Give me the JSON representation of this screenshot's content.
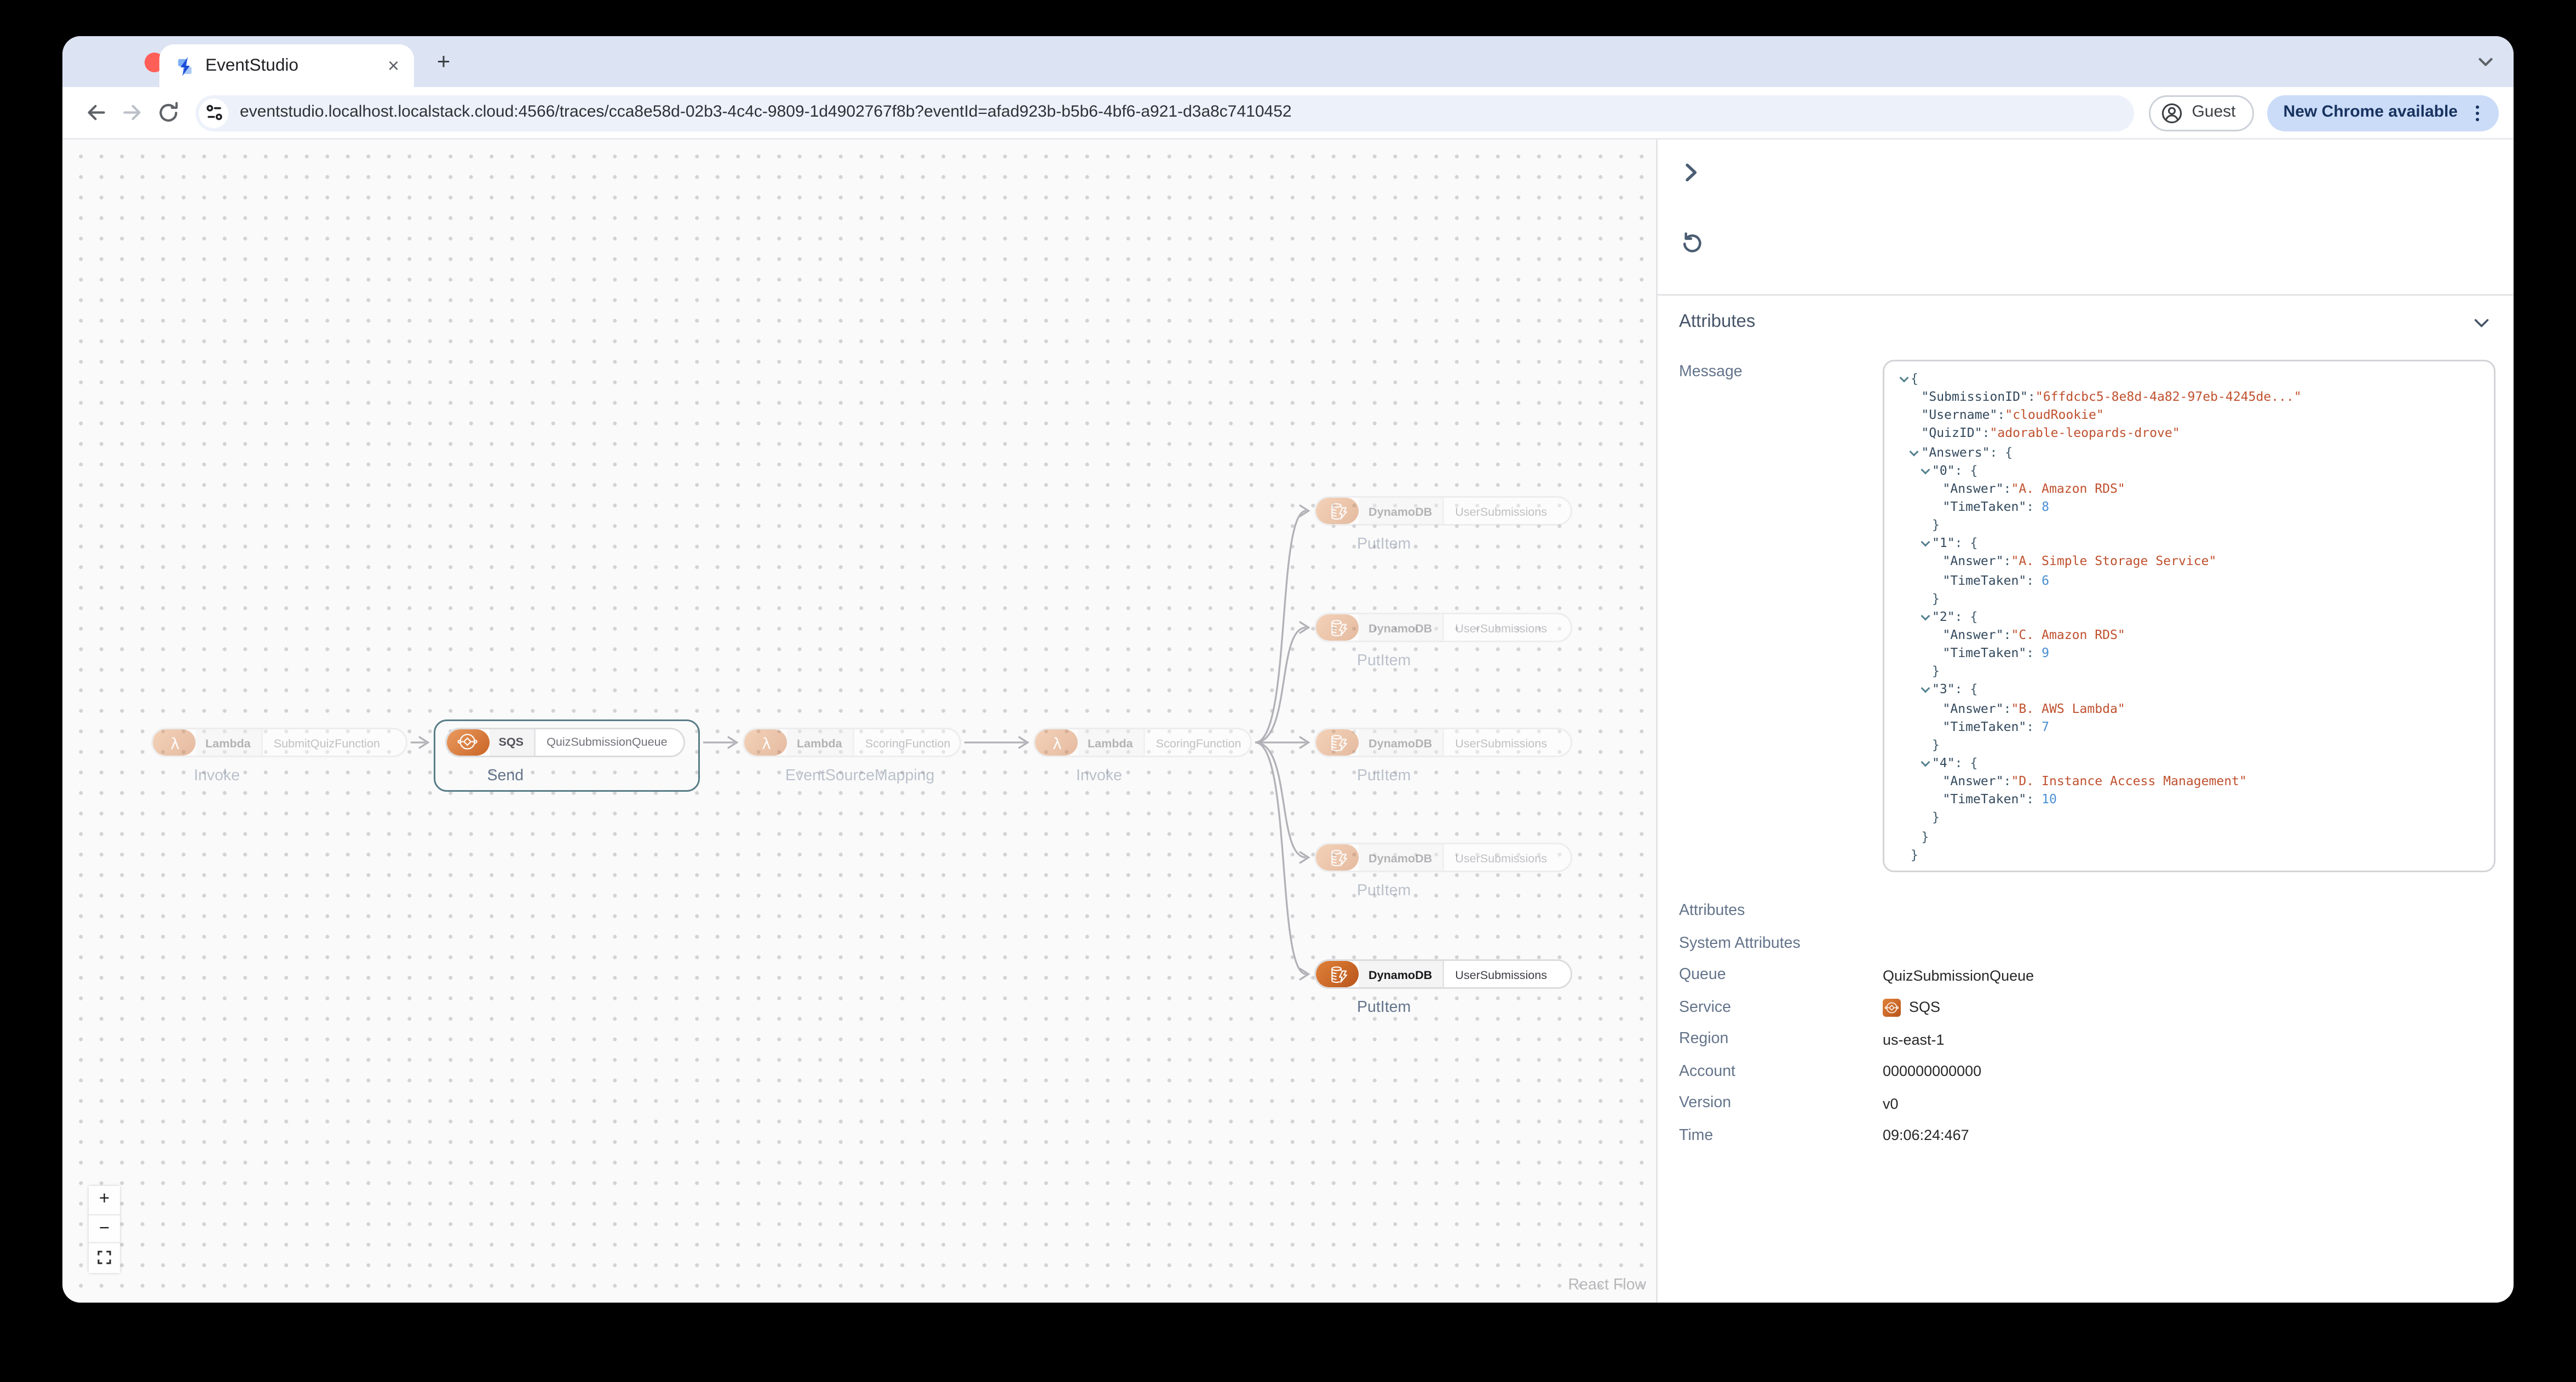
{
  "browser": {
    "tab_title": "EventStudio",
    "url": "eventstudio.localhost.localstack.cloud:4566/traces/cca8e58d-02b3-4c4c-9809-1d4902767f8b?eventId=afad923b-b5b6-4bf6-a921-d3a8c7410452",
    "guest_label": "Guest",
    "update_label": "New Chrome available",
    "new_tab_label": "+",
    "close_tab_label": "×"
  },
  "canvas": {
    "attribution": "React Flow",
    "zoom_in_label": "+",
    "zoom_out_label": "−"
  },
  "flow": {
    "nodes": [
      {
        "id": "lambda-submit",
        "service": "Lambda",
        "resource": "SubmitQuizFunction",
        "action": "Invoke",
        "icon": "lambda",
        "state": "faded"
      },
      {
        "id": "sqs-queue",
        "service": "SQS",
        "resource": "QuizSubmissionQueue",
        "action": "Send",
        "icon": "sqs",
        "state": "selected"
      },
      {
        "id": "lambda-scoring-esm",
        "service": "Lambda",
        "resource": "ScoringFunction",
        "action": "EventSourceMapping",
        "icon": "lambda",
        "state": "faded"
      },
      {
        "id": "lambda-scoring-invoke",
        "service": "Lambda",
        "resource": "ScoringFunction",
        "action": "Invoke",
        "icon": "lambda",
        "state": "faded"
      },
      {
        "id": "ddb-1",
        "service": "DynamoDB",
        "resource": "UserSubmissions",
        "action": "PutItem",
        "icon": "dynamodb",
        "state": "faded"
      },
      {
        "id": "ddb-2",
        "service": "DynamoDB",
        "resource": "UserSubmissions",
        "action": "PutItem",
        "icon": "dynamodb",
        "state": "faded"
      },
      {
        "id": "ddb-3",
        "service": "DynamoDB",
        "resource": "UserSubmissions",
        "action": "PutItem",
        "icon": "dynamodb",
        "state": "faded"
      },
      {
        "id": "ddb-4",
        "service": "DynamoDB",
        "resource": "UserSubmissions",
        "action": "PutItem",
        "icon": "dynamodb",
        "state": "faded"
      },
      {
        "id": "ddb-5",
        "service": "DynamoDB",
        "resource": "UserSubmissions",
        "action": "PutItem",
        "icon": "dynamodb",
        "state": "active"
      }
    ],
    "edges": [
      [
        "lambda-submit",
        "sqs-queue"
      ],
      [
        "sqs-queue",
        "lambda-scoring-esm"
      ],
      [
        "lambda-scoring-esm",
        "lambda-scoring-invoke"
      ],
      [
        "lambda-scoring-invoke",
        "ddb-1"
      ],
      [
        "lambda-scoring-invoke",
        "ddb-2"
      ],
      [
        "lambda-scoring-invoke",
        "ddb-3"
      ],
      [
        "lambda-scoring-invoke",
        "ddb-4"
      ],
      [
        "lambda-scoring-invoke",
        "ddb-5"
      ]
    ]
  },
  "panel": {
    "attributes_header": "Attributes",
    "message_label": "Message",
    "section_links": [
      "Attributes",
      "System Attributes"
    ],
    "fields": [
      {
        "label": "Queue",
        "value": "QuizSubmissionQueue"
      },
      {
        "label": "Service",
        "value": "SQS",
        "icon": "sqs"
      },
      {
        "label": "Region",
        "value": "us-east-1"
      },
      {
        "label": "Account",
        "value": "000000000000"
      },
      {
        "label": "Version",
        "value": "v0"
      },
      {
        "label": "Time",
        "value": "09:06:24:467"
      }
    ],
    "message_lines": [
      {
        "i": 0,
        "caret": true,
        "open": "{"
      },
      {
        "i": 1,
        "key": "SubmissionID",
        "sval": "6ffdcbc5-8e8d-4a82-97eb-4245de..."
      },
      {
        "i": 1,
        "key": "Username",
        "sval": "cloudRookie"
      },
      {
        "i": 1,
        "key": "QuizID",
        "sval": "adorable-leopards-drove"
      },
      {
        "i": 1,
        "caret": true,
        "key": "Answers",
        "open": "{"
      },
      {
        "i": 2,
        "caret": true,
        "key": "0",
        "open": "{"
      },
      {
        "i": 3,
        "key": "Answer",
        "sval": "A. Amazon RDS"
      },
      {
        "i": 3,
        "key": "TimeTaken",
        "nval": "8"
      },
      {
        "i": 2,
        "close": "}"
      },
      {
        "i": 2,
        "caret": true,
        "key": "1",
        "open": "{"
      },
      {
        "i": 3,
        "key": "Answer",
        "sval": "A. Simple Storage Service"
      },
      {
        "i": 3,
        "key": "TimeTaken",
        "nval": "6"
      },
      {
        "i": 2,
        "close": "}"
      },
      {
        "i": 2,
        "caret": true,
        "key": "2",
        "open": "{"
      },
      {
        "i": 3,
        "key": "Answer",
        "sval": "C. Amazon RDS"
      },
      {
        "i": 3,
        "key": "TimeTaken",
        "nval": "9"
      },
      {
        "i": 2,
        "close": "}"
      },
      {
        "i": 2,
        "caret": true,
        "key": "3",
        "open": "{"
      },
      {
        "i": 3,
        "key": "Answer",
        "sval": "B. AWS Lambda"
      },
      {
        "i": 3,
        "key": "TimeTaken",
        "nval": "7"
      },
      {
        "i": 2,
        "close": "}"
      },
      {
        "i": 2,
        "caret": true,
        "key": "4",
        "open": "{"
      },
      {
        "i": 3,
        "key": "Answer",
        "sval": "D. Instance Access Management"
      },
      {
        "i": 3,
        "key": "TimeTaken",
        "nval": "10"
      },
      {
        "i": 2,
        "close": "}"
      },
      {
        "i": 1,
        "close": "}"
      },
      {
        "i": 0,
        "close": "}"
      }
    ]
  },
  "icons": {
    "favicon": "eventstudio-bolt",
    "traffic_lights": [
      "close",
      "minimize",
      "zoom"
    ],
    "omnibox_icon": "site-settings-sliders",
    "node_icons": [
      "lambda",
      "sqs",
      "dynamodb"
    ],
    "panel_icons": [
      "chevron-right",
      "restart",
      "chevron-down"
    ],
    "zoom_controls": [
      "plus",
      "minus",
      "fit-view"
    ]
  },
  "colors": {
    "aws_orange": "#c96526",
    "selection_border": "#587d88",
    "json_key": "#33495d",
    "json_string": "#c0512f",
    "json_number": "#4a8fd4",
    "edge": "#b1b1b7",
    "update_pill_bg": "#cbdcf8",
    "tabstrip_bg": "#dce3f3"
  }
}
